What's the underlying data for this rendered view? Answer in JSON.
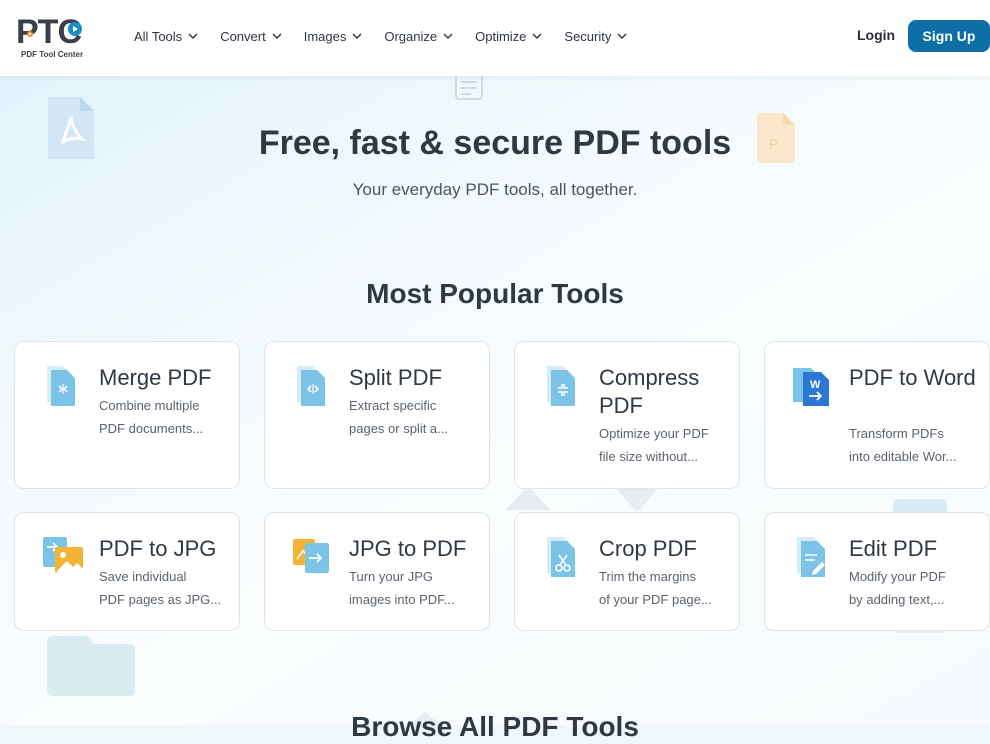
{
  "brand": {
    "logo_text": "PTC",
    "logo_subtitle": "PDF Tool Center"
  },
  "nav": {
    "items": [
      {
        "label": "All Tools"
      },
      {
        "label": "Convert"
      },
      {
        "label": "Images"
      },
      {
        "label": "Organize"
      },
      {
        "label": "Optimize"
      },
      {
        "label": "Security"
      }
    ],
    "login_label": "Login",
    "signup_label": "Sign Up"
  },
  "hero": {
    "title": "Free, fast & secure PDF tools",
    "subtitle": "Your everyday PDF tools, all together."
  },
  "popular": {
    "heading": "Most Popular Tools",
    "tools": [
      {
        "title": "Merge PDF",
        "desc1": "Combine multiple",
        "desc2": "PDF documents...",
        "icon": "merge-icon"
      },
      {
        "title": "Split PDF",
        "desc1": "Extract specific",
        "desc2": "pages or split a...",
        "icon": "split-icon"
      },
      {
        "title": "Compress PDF",
        "desc1": "Optimize your PDF",
        "desc2": "file size without...",
        "icon": "compress-icon"
      },
      {
        "title": "PDF to Word",
        "desc1": "Transform PDFs",
        "desc2": "into editable Wor...",
        "icon": "word-icon"
      },
      {
        "title": "PDF to JPG",
        "desc1": "Save individual",
        "desc2": "PDF pages as JPG...",
        "icon": "pdf-to-jpg-icon"
      },
      {
        "title": "JPG to PDF",
        "desc1": "Turn your JPG",
        "desc2": "images into PDF...",
        "icon": "jpg-to-pdf-icon"
      },
      {
        "title": "Crop PDF",
        "desc1": "Trim the margins",
        "desc2": "of your PDF page...",
        "icon": "crop-icon"
      },
      {
        "title": "Edit PDF",
        "desc1": "Modify your PDF",
        "desc2": "by adding text,...",
        "icon": "edit-icon"
      }
    ]
  },
  "browse": {
    "heading": "Browse All PDF Tools"
  },
  "colors": {
    "accent": "#0d6fa6",
    "icon_blue": "#7cc3e8",
    "icon_yellow": "#f5b335",
    "word_blue": "#2b78d4"
  }
}
